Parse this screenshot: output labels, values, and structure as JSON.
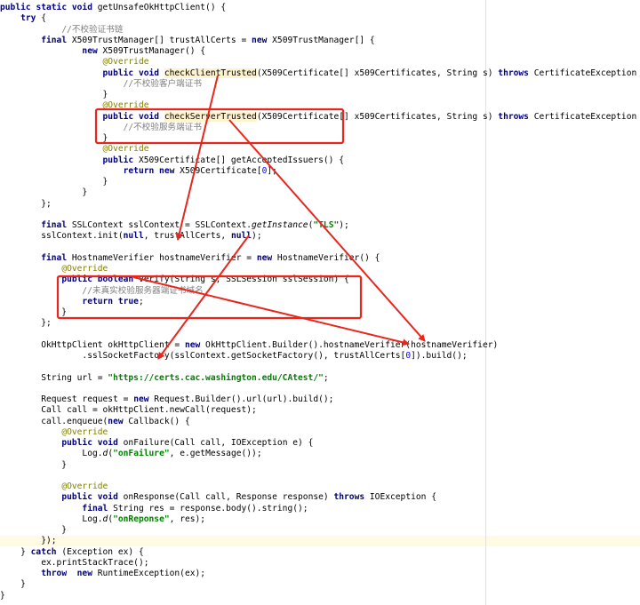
{
  "code_lines": [
    [
      [
        "kw",
        "public "
      ],
      [
        "kw",
        "static "
      ],
      [
        "kw",
        "void "
      ],
      [
        "",
        "getUnsafeOkHttpClient() {"
      ]
    ],
    [
      [
        "",
        "    "
      ],
      [
        "kw",
        "try "
      ],
      [
        "",
        "{"
      ]
    ],
    [
      [
        "",
        "            "
      ],
      [
        "cmt",
        "//不校验证书链"
      ]
    ],
    [
      [
        "",
        "        "
      ],
      [
        "kw",
        "final "
      ],
      [
        "",
        "X509TrustManager[] trustAllCerts = "
      ],
      [
        "kw",
        "new "
      ],
      [
        "",
        "X509TrustManager[] {"
      ]
    ],
    [
      [
        "",
        "                "
      ],
      [
        "kw",
        "new "
      ],
      [
        "",
        "X509TrustManager() {"
      ]
    ],
    [
      [
        "",
        "                    "
      ],
      [
        "ann",
        "@Override"
      ]
    ],
    [
      [
        "",
        "                    "
      ],
      [
        "kw",
        "public "
      ],
      [
        "kw",
        "void "
      ],
      [
        "hl",
        "checkClientTrusted"
      ],
      [
        "",
        "(X509Certificate[] x509Certificates, String s) "
      ],
      [
        "kw",
        "throws "
      ],
      [
        "",
        "CertificateException {"
      ]
    ],
    [
      [
        "",
        "                        "
      ],
      [
        "cmt",
        "//不校验客户端证书"
      ]
    ],
    [
      [
        "",
        "                    }"
      ]
    ],
    [
      [
        "",
        "                    "
      ],
      [
        "ann",
        "@Override"
      ]
    ],
    [
      [
        "",
        "                    "
      ],
      [
        "kw",
        "public "
      ],
      [
        "kw",
        "void "
      ],
      [
        "hl",
        "checkServerTrusted"
      ],
      [
        "",
        "(X509Certificate[] x509Certificates, String s) "
      ],
      [
        "kw",
        "throws "
      ],
      [
        "",
        "CertificateException {"
      ]
    ],
    [
      [
        "",
        "                        "
      ],
      [
        "cmt",
        "//不校验服务端证书"
      ]
    ],
    [
      [
        "",
        "                    }"
      ]
    ],
    [
      [
        "",
        "                    "
      ],
      [
        "ann",
        "@Override"
      ]
    ],
    [
      [
        "",
        "                    "
      ],
      [
        "kw",
        "public "
      ],
      [
        "",
        "X509Certificate[] getAcceptedIssuers() {"
      ]
    ],
    [
      [
        "",
        "                        "
      ],
      [
        "kw",
        "return new "
      ],
      [
        "",
        "X509Certificate["
      ],
      [
        "num",
        "0"
      ],
      [
        "",
        "];"
      ]
    ],
    [
      [
        "",
        "                    }"
      ]
    ],
    [
      [
        "",
        "                }"
      ]
    ],
    [
      [
        "",
        "        };"
      ]
    ],
    [
      [
        "",
        ""
      ]
    ],
    [
      [
        "",
        "        "
      ],
      [
        "kw",
        "final "
      ],
      [
        "",
        "SSLContext sslContext = SSLContext."
      ],
      [
        "it",
        "getInstance"
      ],
      [
        "",
        "("
      ],
      [
        "str",
        "\"TLS\""
      ],
      [
        "",
        ");"
      ]
    ],
    [
      [
        "",
        "        sslContext.init("
      ],
      [
        "kw",
        "null"
      ],
      [
        "",
        ", trustAllCerts, "
      ],
      [
        "kw",
        "null"
      ],
      [
        "",
        ");"
      ]
    ],
    [
      [
        "",
        ""
      ]
    ],
    [
      [
        "",
        "        "
      ],
      [
        "kw",
        "final "
      ],
      [
        "",
        "HostnameVerifier hostnameVerifier = "
      ],
      [
        "kw",
        "new "
      ],
      [
        "",
        "HostnameVerifier() {"
      ]
    ],
    [
      [
        "",
        "            "
      ],
      [
        "ann",
        "@Override"
      ]
    ],
    [
      [
        "",
        "            "
      ],
      [
        "kw",
        "public "
      ],
      [
        "kw",
        "boolean "
      ],
      [
        "",
        "verify(String s, SSLSession sslSession) {"
      ]
    ],
    [
      [
        "",
        "                "
      ],
      [
        "cmt",
        "//未真实校验服务器端证书域名"
      ]
    ],
    [
      [
        "",
        "                "
      ],
      [
        "kw",
        "return "
      ],
      [
        "kw",
        "true"
      ],
      [
        "",
        ";"
      ]
    ],
    [
      [
        "",
        "            }"
      ]
    ],
    [
      [
        "",
        "        };"
      ]
    ],
    [
      [
        "",
        ""
      ]
    ],
    [
      [
        "",
        "        OkHttpClient okHttpClient = "
      ],
      [
        "kw",
        "new "
      ],
      [
        "",
        "OkHttpClient.Builder().hostnameVerifier(hostnameVerifier)"
      ]
    ],
    [
      [
        "",
        "                .sslSocketFactory(sslContext.getSocketFactory(), trustAllCerts["
      ],
      [
        "num",
        "0"
      ],
      [
        "",
        "]).build();"
      ]
    ],
    [
      [
        "",
        ""
      ]
    ],
    [
      [
        "",
        "        String url = "
      ],
      [
        "str",
        "\"https://certs.cac.washington.edu/CAtest/\""
      ],
      [
        "",
        ";"
      ]
    ],
    [
      [
        "",
        ""
      ]
    ],
    [
      [
        "",
        "        Request request = "
      ],
      [
        "kw",
        "new "
      ],
      [
        "",
        "Request.Builder().url(url).build();"
      ]
    ],
    [
      [
        "",
        "        Call call = okHttpClient.newCall(request);"
      ]
    ],
    [
      [
        "",
        "        call.enqueue("
      ],
      [
        "kw",
        "new "
      ],
      [
        "",
        "Callback() {"
      ]
    ],
    [
      [
        "",
        "            "
      ],
      [
        "ann",
        "@Override"
      ]
    ],
    [
      [
        "",
        "            "
      ],
      [
        "kw",
        "public "
      ],
      [
        "kw",
        "void "
      ],
      [
        "",
        "onFailure(Call call, IOException e) {"
      ]
    ],
    [
      [
        "",
        "                Log."
      ],
      [
        "it",
        "d"
      ],
      [
        "",
        "("
      ],
      [
        "str",
        "\"onFailure\""
      ],
      [
        "",
        ", e.getMessage());"
      ]
    ],
    [
      [
        "",
        "            }"
      ]
    ],
    [
      [
        "",
        ""
      ]
    ],
    [
      [
        "",
        "            "
      ],
      [
        "ann",
        "@Override"
      ]
    ],
    [
      [
        "",
        "            "
      ],
      [
        "kw",
        "public "
      ],
      [
        "kw",
        "void "
      ],
      [
        "",
        "onResponse(Call call, Response response) "
      ],
      [
        "kw",
        "throws "
      ],
      [
        "",
        "IOException {"
      ]
    ],
    [
      [
        "",
        "                "
      ],
      [
        "kw",
        "final "
      ],
      [
        "",
        "String res = response.body().string();"
      ]
    ],
    [
      [
        "",
        "                Log."
      ],
      [
        "it",
        "d"
      ],
      [
        "",
        "("
      ],
      [
        "str",
        "\"onReponse\""
      ],
      [
        "",
        ", res);"
      ]
    ],
    [
      [
        "",
        "            }"
      ]
    ],
    [
      [
        "",
        "        });"
      ]
    ],
    [
      [
        "",
        "    } "
      ],
      [
        "kw",
        "catch "
      ],
      [
        "",
        "(Exception ex) {"
      ]
    ],
    [
      [
        "",
        "        ex.printStackTrace();"
      ]
    ],
    [
      [
        "",
        "        "
      ],
      [
        "kw",
        "throw  new "
      ],
      [
        "",
        "RuntimeException(ex);"
      ]
    ],
    [
      [
        "",
        "    }"
      ]
    ],
    [
      [
        "",
        "}"
      ]
    ]
  ],
  "colors": {
    "keyword": "#000080",
    "string": "#008000",
    "comment": "#808080",
    "annotation": "#808000",
    "number": "#0000ff",
    "annotation_box": "#e8261c",
    "arrow": "#e8261c",
    "method_highlight": "#fff3cf"
  }
}
